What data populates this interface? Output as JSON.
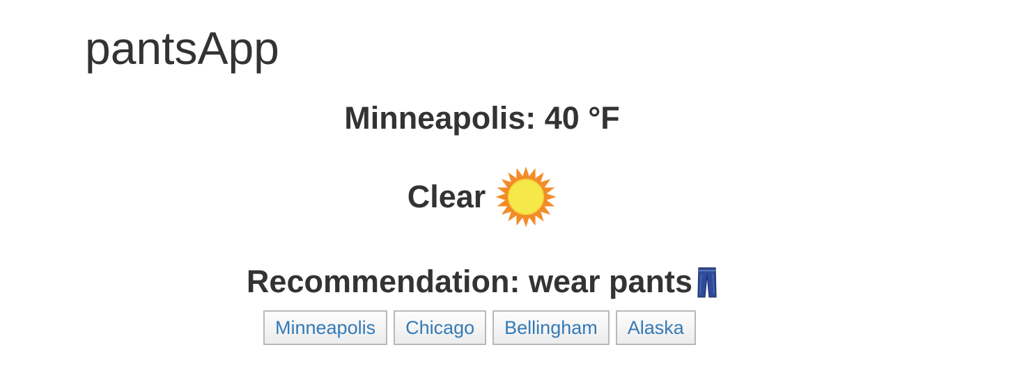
{
  "app": {
    "title": "pantsApp"
  },
  "weather": {
    "summary": "Minneapolis: 40 °F",
    "condition": "Clear",
    "condition_icon": "sun-icon",
    "recommendation": "Recommendation: wear pants",
    "recommendation_icon": "jeans-icon"
  },
  "cities": [
    {
      "label": "Minneapolis"
    },
    {
      "label": "Chicago"
    },
    {
      "label": "Bellingham"
    },
    {
      "label": "Alaska"
    }
  ],
  "colors": {
    "text": "#333333",
    "link": "#337ab7",
    "button_border": "#b8b8b8",
    "sun_core": "#f5e94a",
    "sun_rays": "#f28c28",
    "jeans": "#2f4b9a"
  }
}
